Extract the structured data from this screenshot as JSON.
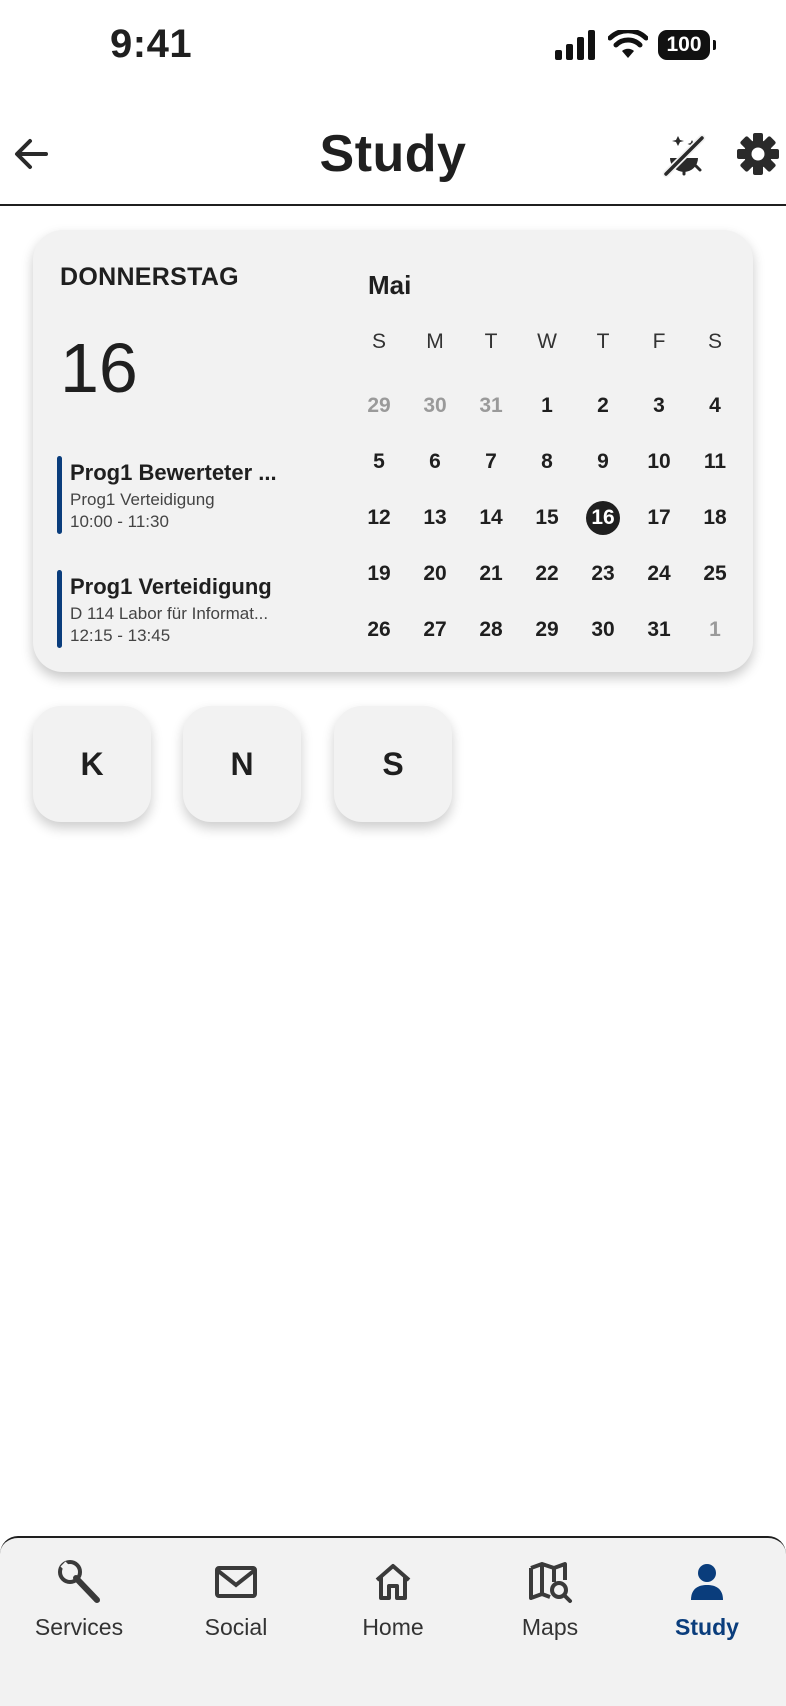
{
  "status_bar": {
    "time": "9:41",
    "battery": "100"
  },
  "header": {
    "title": "Study"
  },
  "calendar": {
    "weekday": "DONNERSTAG",
    "day": "16",
    "events": [
      {
        "title": "Prog1 Bewerteter ...",
        "line1": "Prog1 Verteidigung",
        "line2": "10:00 - 11:30"
      },
      {
        "title": "Prog1 Verteidigung",
        "line1": "D 114 Labor für Informat...",
        "line2": "12:15 - 13:45"
      }
    ],
    "month": "Mai",
    "day_headers": [
      "S",
      "M",
      "T",
      "W",
      "T",
      "F",
      "S"
    ],
    "weeks": [
      [
        "29",
        "30",
        "31",
        "1",
        "2",
        "3",
        "4"
      ],
      [
        "5",
        "6",
        "7",
        "8",
        "9",
        "10",
        "11"
      ],
      [
        "12",
        "13",
        "14",
        "15",
        "16",
        "17",
        "18"
      ],
      [
        "19",
        "20",
        "21",
        "22",
        "23",
        "24",
        "25"
      ],
      [
        "26",
        "27",
        "28",
        "29",
        "30",
        "31",
        "1"
      ]
    ]
  },
  "quick_buttons": [
    {
      "label": "K"
    },
    {
      "label": "N"
    },
    {
      "label": "S"
    }
  ],
  "nav": {
    "items": [
      {
        "label": "Services",
        "icon": "wrench-icon"
      },
      {
        "label": "Social",
        "icon": "mail-icon"
      },
      {
        "label": "Home",
        "icon": "home-icon"
      },
      {
        "label": "Maps",
        "icon": "map-search-icon"
      },
      {
        "label": "Study",
        "icon": "person-icon",
        "active": true
      }
    ]
  },
  "colors": {
    "accent": "#0a3d7c",
    "text": "#1f1f1f",
    "card": "#f2f2f2",
    "muted": "#9a9a9a"
  }
}
